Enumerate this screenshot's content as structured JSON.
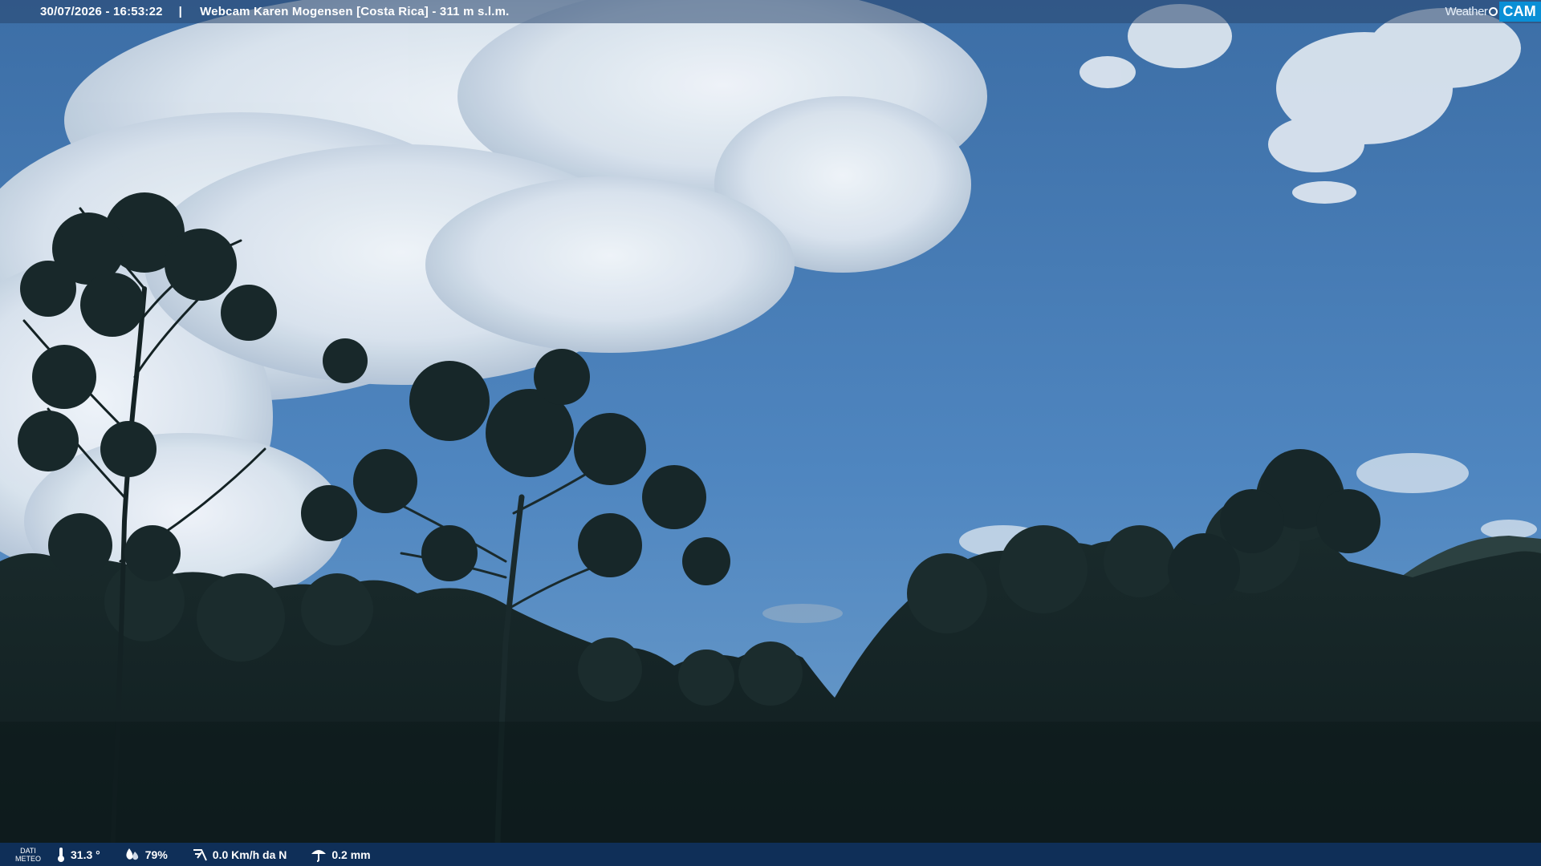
{
  "header": {
    "timestamp": "30/07/2026 - 16:53:22",
    "separator": "|",
    "title": "Webcam Karen Mogensen [Costa Rica]  - 311 m s.l.m.",
    "logo_weather": "Weather",
    "logo_cam": "CAM"
  },
  "footer": {
    "label_line1": "DATI",
    "label_line2": "METEO",
    "temperature": "31.3 °",
    "humidity": "79%",
    "wind": "0.0 Km/h da N",
    "rain": "0.2 mm"
  },
  "colors": {
    "sky_top": "#3a6ea8",
    "sky_bottom": "#6aa0d4",
    "bar_bottom": "#0f2f58",
    "logo_accent": "#0a8fd6"
  },
  "icons": [
    "thermometer-icon",
    "humidity-icon",
    "wind-icon",
    "rain-icon"
  ]
}
